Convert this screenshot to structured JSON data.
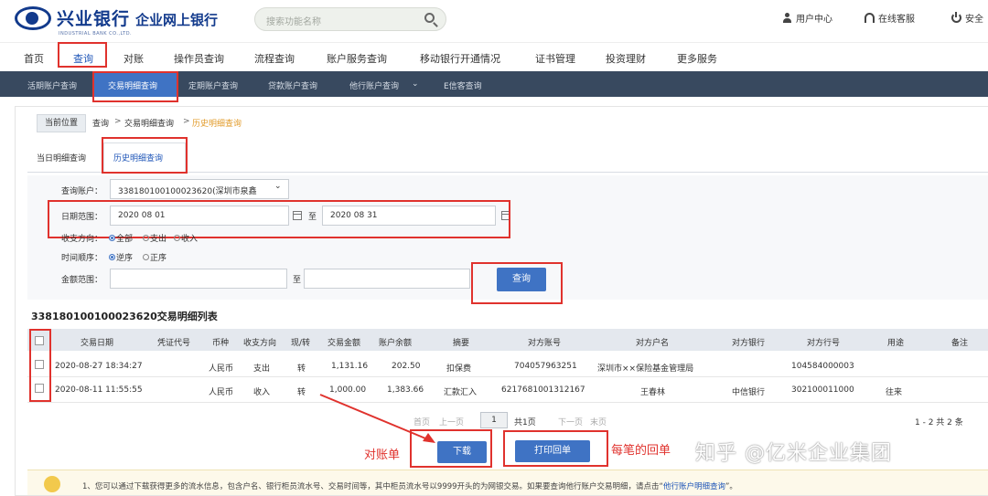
{
  "header": {
    "bank_name": "兴业银行",
    "site_name": "企业网上银行",
    "bank_en": "INDUSTRIAL BANK CO.,LTD.",
    "search_placeholder": "搜索功能名称",
    "user_center": "用户中心",
    "online_service": "在线客服",
    "logout": "安全"
  },
  "nav_main": [
    "首页",
    "查询",
    "对账",
    "操作员查询",
    "流程查询",
    "账户服务查询",
    "移动银行开通情况",
    "证书管理",
    "投资理财",
    "更多服务"
  ],
  "nav_sub": [
    "活期账户查询",
    "交易明细查询",
    "定期账户查询",
    "贷款账户查询",
    "他行账户查询",
    "E信客查询"
  ],
  "breadcrumb": {
    "tag": "当前位置",
    "items": [
      "查询",
      "交易明细查询",
      "历史明细查询"
    ]
  },
  "tabs": [
    "当日明细查询",
    "历史明细查询"
  ],
  "filters": {
    "account_label": "查询账户：",
    "account_value": "338180100100023620(深圳市泉鑫",
    "date_label": "日期范围：",
    "date_from": "2020 08 01",
    "date_to_sep": "至",
    "date_to": "2020 08 31",
    "direction_label": "收支方向：",
    "direction_options": [
      "全部",
      "支出",
      "收入"
    ],
    "order_label": "时间顺序：",
    "order_options": [
      "逆序",
      "正序"
    ],
    "amount_label": "金额范围：",
    "amount_sep": "至",
    "query_button": "查询"
  },
  "list": {
    "title": "338180100100023620交易明细列表",
    "columns": [
      "交易日期",
      "凭证代号",
      "币种",
      "收支方向",
      "现/转",
      "交易金额",
      "账户余额",
      "摘要",
      "对方账号",
      "对方户名",
      "对方银行",
      "对方行号",
      "用途",
      "备注"
    ],
    "rows": [
      [
        "2020-08-27 18:34:27",
        "",
        "人民币",
        "支出",
        "转",
        "1,131.16",
        "202.50",
        "扣保费",
        "704057963251",
        "深圳市××保险基金管理局",
        "",
        "104584000003",
        "",
        ""
      ],
      [
        "2020-08-11 11:55:55",
        "",
        "人民币",
        "收入",
        "转",
        "1,000.00",
        "1,383.66",
        "汇款汇入",
        "6217681001312167",
        "王春林",
        "中信银行",
        "302100011000",
        "往来",
        ""
      ]
    ]
  },
  "pager": {
    "first": "首页",
    "prev": "上一页",
    "current": "1",
    "total": "共1页",
    "next": "下一页",
    "last": "末页",
    "range": "1 - 2  共 2 条"
  },
  "actions": {
    "download": "下载",
    "print": "打印回单"
  },
  "annotations": {
    "left": "对账单",
    "right": "每笔的回单"
  },
  "watermark": "知乎 @亿米企业集团",
  "notice": {
    "text": "1、您可以通过下载获得更多的流水信息，包含户名、银行柜员流水号、交易时间等，其中柜员流水号以9999开头的为网银交易。如果要查询他行账户交易明细，请点击“",
    "link": "他行账户明细查询",
    "tail": "”。"
  },
  "colors": {
    "nav_dark": "#38495f",
    "accent_blue": "#3f73c4",
    "annotation_red": "#e0322d",
    "brand": "#123a8c"
  }
}
